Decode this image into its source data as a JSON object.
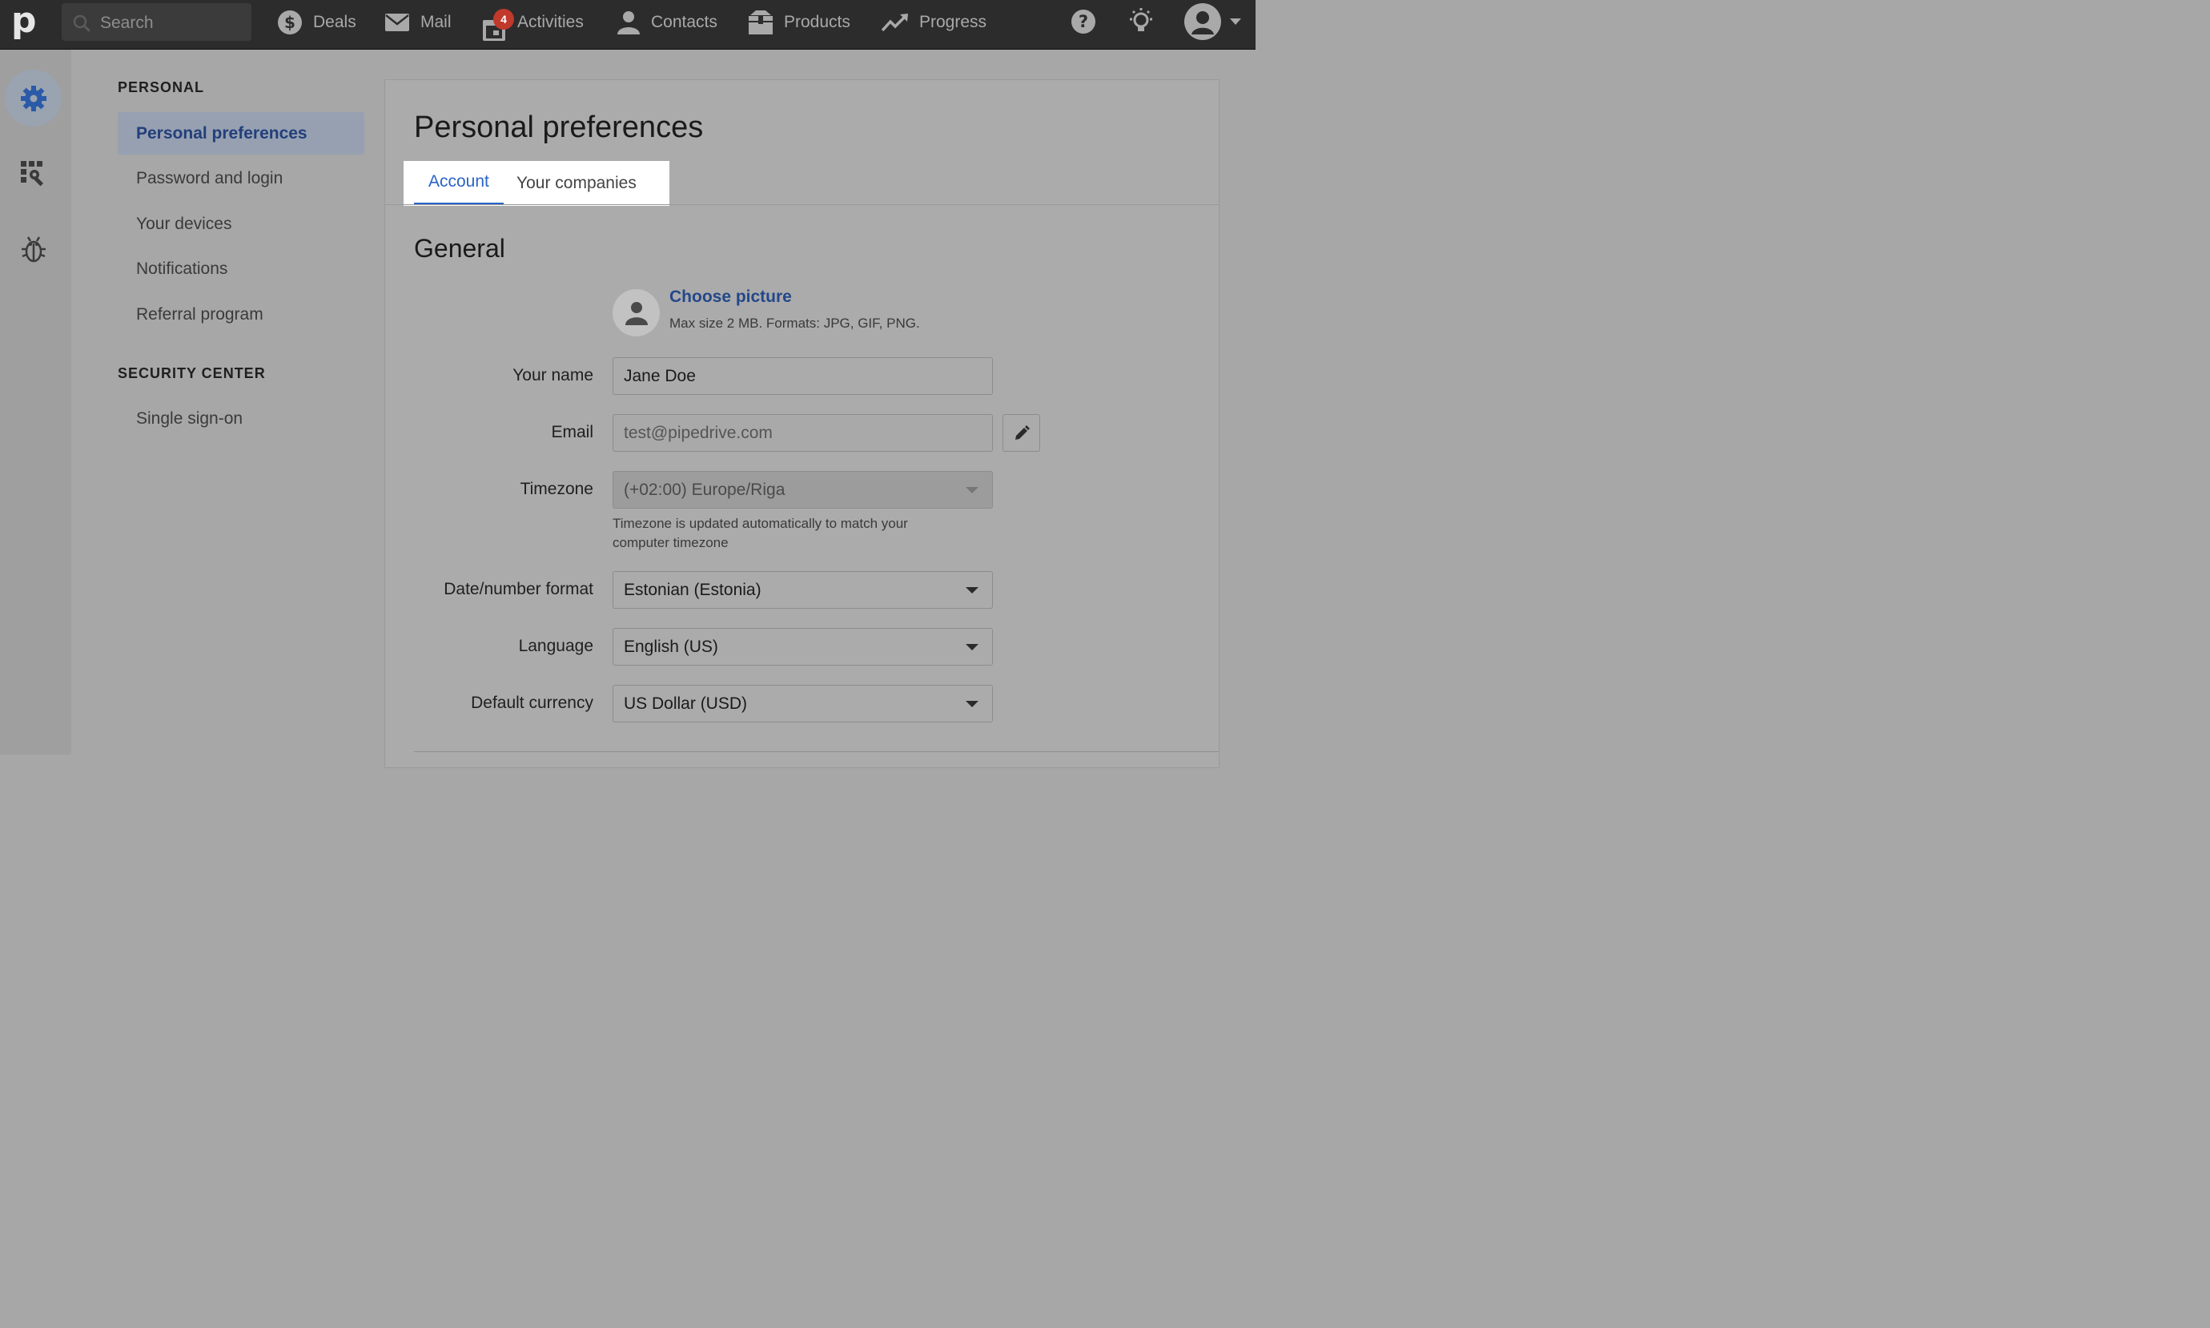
{
  "topnav": {
    "logo": "p",
    "search_placeholder": "Search",
    "items": [
      {
        "label": "Deals",
        "icon": "dollar-circle-icon"
      },
      {
        "label": "Mail",
        "icon": "envelope-icon"
      },
      {
        "label": "Activities",
        "icon": "calendar-icon",
        "badge": "4"
      },
      {
        "label": "Contacts",
        "icon": "person-icon"
      },
      {
        "label": "Products",
        "icon": "box-icon"
      },
      {
        "label": "Progress",
        "icon": "trend-up-icon"
      }
    ],
    "right_icons": [
      "help-icon",
      "lightbulb-icon",
      "user-avatar-icon",
      "chevron-down-icon"
    ]
  },
  "rail": {
    "icons": [
      "settings-gear-icon",
      "tools-icon",
      "bug-icon"
    ]
  },
  "sidebar": {
    "personal_heading": "PERSONAL",
    "personal_items": [
      {
        "label": "Personal preferences",
        "active": true
      },
      {
        "label": "Password and login",
        "active": false
      },
      {
        "label": "Your devices",
        "active": false
      },
      {
        "label": "Notifications",
        "active": false
      },
      {
        "label": "Referral program",
        "active": false
      }
    ],
    "security_heading": "SECURITY CENTER",
    "security_items": [
      {
        "label": "Single sign-on",
        "active": false
      }
    ]
  },
  "main": {
    "title": "Personal preferences",
    "tabs": [
      {
        "label": "Account",
        "active": true
      },
      {
        "label": "Your companies",
        "active": false
      }
    ],
    "section_heading": "General",
    "picture": {
      "link": "Choose picture",
      "hint": "Max size 2 MB. Formats: JPG, GIF, PNG."
    },
    "fields": {
      "name": {
        "label": "Your name",
        "value": "Jane Doe"
      },
      "email": {
        "label": "Email",
        "value": "test@pipedrive.com"
      },
      "timezone": {
        "label": "Timezone",
        "value": "(+02:00) Europe/Riga",
        "hint": "Timezone is updated automatically to match your computer timezone"
      },
      "date_format": {
        "label": "Date/number format",
        "value": "Estonian (Estonia)"
      },
      "language": {
        "label": "Language",
        "value": "English (US)"
      },
      "currency": {
        "label": "Default currency",
        "value": "US Dollar (USD)"
      }
    }
  },
  "colors": {
    "topbar": "#2c2c2c",
    "accent_blue": "#2a64c8",
    "badge_red": "#c0392b"
  }
}
